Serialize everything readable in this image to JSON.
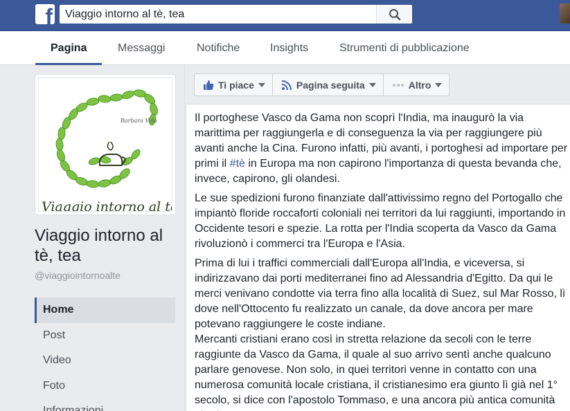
{
  "topbar": {
    "logo": "f",
    "search_value": "Viaggio intorno al tè, tea"
  },
  "tabs": [
    {
      "label": "Pagina",
      "active": true
    },
    {
      "label": "Messaggi"
    },
    {
      "label": "Notifiche"
    },
    {
      "label": "Insights"
    },
    {
      "label": "Strumenti di pubblicazione"
    }
  ],
  "page": {
    "name": "Viaggio intorno al tè, tea",
    "handle": "@viaggiointornoalte",
    "logo_author": "Barbara Vola",
    "logo_text": "Viaggio intorno al tè"
  },
  "nav": [
    {
      "label": "Home",
      "active": true
    },
    {
      "label": "Post"
    },
    {
      "label": "Video"
    },
    {
      "label": "Foto"
    },
    {
      "label": "Informazioni"
    }
  ],
  "actions": {
    "like": "Ti piace",
    "follow": "Pagina seguita",
    "more": "Altro"
  },
  "post": {
    "p1_before": "Il portoghese Vasco da Gama non scoprì l'India, ma inaugurò la via marittima per raggiungerla e di conseguenza la via per raggiungere più avanti anche la Cina. Furono infatti, più avanti, i portoghesi ad importare per primi il ",
    "p1_hashtag": "#tè",
    "p1_after": " in Europa ma non capirono l'importanza di questa bevanda che, invece, capirono, gli olandesi.",
    "p2": "Le sue spedizioni furono finanziate dall'attivissimo regno del Portogallo che impiantò floride roccaforti coloniali nei territori da lui raggiunti, importando in Occidente tesori e spezie. La rotta per l'India scoperta da Vasco da Gama rivoluzionò i commerci tra l'Europa e l'Asia.",
    "p3": "Prima di lui i traffici commerciali dall'Europa all'India, e viceversa, si indirizzavano dai porti mediterranei fino ad Alessandria d'Egitto. Da qui le merci venivano condotte via terra fino alla località di Suez, sul Mar Rosso, lì dove nell'Ottocento fu realizzato un canale, da dove ancora per mare potevano raggiungere le coste indiane.",
    "p4": "Mercanti cristiani erano così in stretta relazione da secoli con le terre raggiunte da Vasco da Gama, il quale al suo arrivo sentì anche qualcuno parlare genovese. Non solo, in quei territori venne in contatto con una numerosa comunità locale cristiana, il cristianesimo era giunto lì già nel 1° secolo, si dice con l'apostolo Tommaso, e una ancora più antica comunità ebraica."
  },
  "colors": {
    "brand": "#3b5998",
    "link": "#365899",
    "background": "#e9ebee"
  },
  "icons": [
    "facebook-logo-icon",
    "search-icon",
    "thumbs-up-icon",
    "rss-icon",
    "more-dots-icon",
    "caret-down-icon"
  ]
}
